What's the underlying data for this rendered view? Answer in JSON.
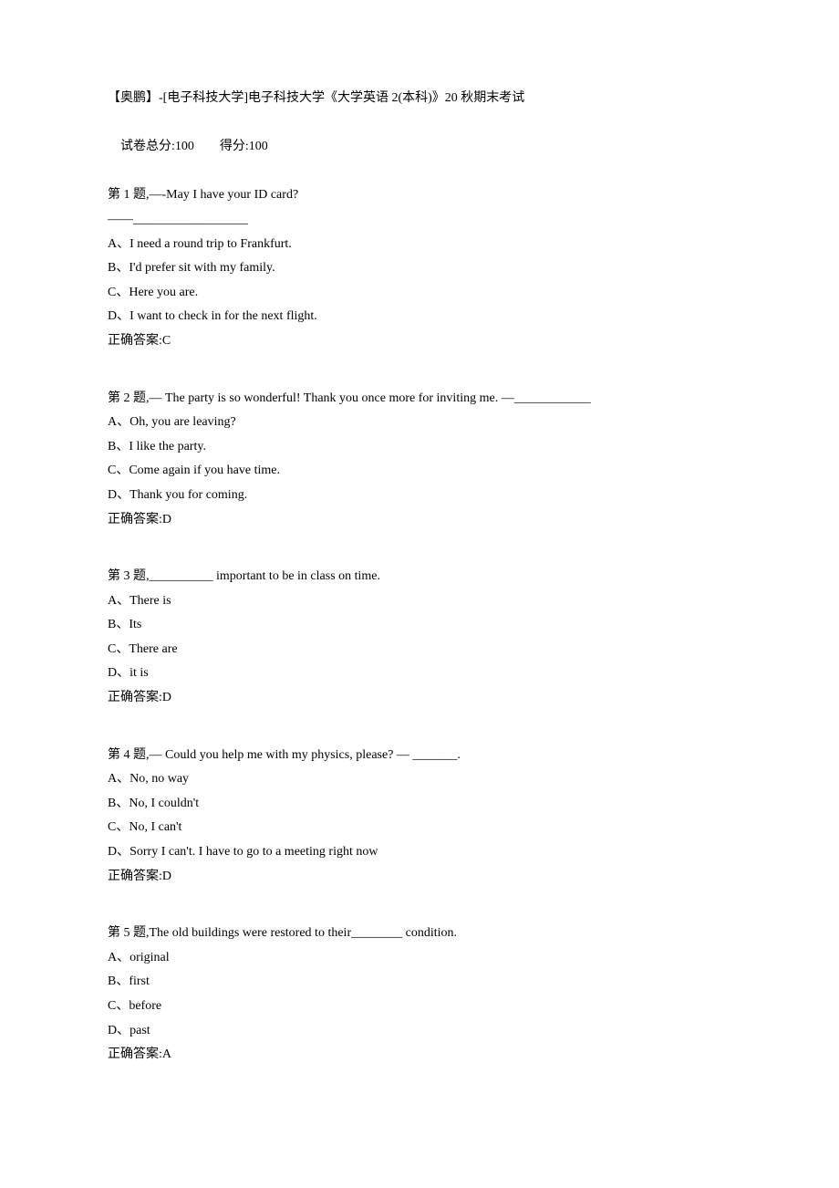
{
  "header": {
    "title": "【奥鹏】-[电子科技大学]电子科技大学《大学英语 2(本科)》20 秋期末考试",
    "score_line_prefix": "试卷总分:",
    "score_total": "100",
    "score_line_mid": "得分:",
    "score_obtained": "100"
  },
  "questions": [
    {
      "prompt_lines": [
        "第 1 题,—-May I have your ID card?",
        "——__________________"
      ],
      "options": [
        "A、I need a round trip to Frankfurt.",
        "B、I'd prefer sit with my family.",
        "C、Here you are.",
        "D、I want to check in for the next flight."
      ],
      "answer": "正确答案:C"
    },
    {
      "prompt_lines": [
        "第 2 题,— The party is so wonderful! Thank you once more for inviting me. —____________"
      ],
      "options": [
        "A、Oh, you are leaving?",
        "B、I like the party.",
        "C、Come again if you have time.",
        "D、Thank you for coming."
      ],
      "answer": "正确答案:D"
    },
    {
      "prompt_lines": [
        "第 3 题,__________ important to be in class on time."
      ],
      "options": [
        "A、There is",
        "B、Its",
        "C、There are",
        "D、it is"
      ],
      "answer": "正确答案:D"
    },
    {
      "prompt_lines": [
        "第 4 题,— Could you help me with my physics, please? — _______."
      ],
      "options": [
        "A、No, no way",
        "B、No, I couldn't",
        "C、No, I can't",
        "D、Sorry I can't. I have to go to a meeting right now"
      ],
      "answer": "正确答案:D"
    },
    {
      "prompt_lines": [
        "第 5 题,The old buildings were restored to their________ condition."
      ],
      "options": [
        "A、original",
        "B、first",
        "C、before",
        "D、past"
      ],
      "answer": "正确答案:A"
    }
  ]
}
